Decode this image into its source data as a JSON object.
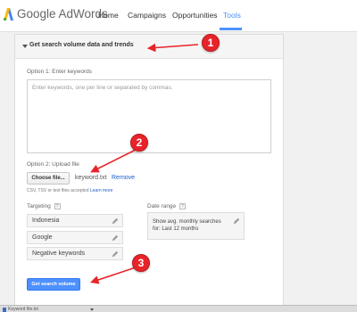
{
  "app": {
    "logo_text": "Google AdWords",
    "logo_colors": {
      "blue": "#4285f4",
      "yellow": "#fbbc05",
      "green": "#34a853"
    }
  },
  "nav": {
    "items": [
      {
        "label": "Home",
        "active": false
      },
      {
        "label": "Campaigns",
        "active": false
      },
      {
        "label": "Opportunities",
        "active": false
      },
      {
        "label": "Tools",
        "active": true
      }
    ],
    "accent_color": "#4d90fe"
  },
  "panel": {
    "title": "Get search volume data and trends",
    "option1": {
      "label": "Option 1: Enter keywords",
      "placeholder": "Enter keywords, one per line or separated by commas."
    },
    "option2": {
      "label": "Option 2: Upload file",
      "choose_button": "Choose file...",
      "filename": "keyword.txt",
      "remove_link": "Remove",
      "help_prefix": "CSV, TSV or text files accepted ",
      "help_link": "Learn more"
    },
    "targeting": {
      "label": "Targeting",
      "help_icon": "?",
      "fields": [
        "Indonesia",
        "Google",
        "Negative keywords"
      ]
    },
    "date_range": {
      "label": "Date range",
      "help_icon": "?",
      "value": "Show avg. monthly searches for: Last 12 months"
    },
    "submit_button": "Get search volume"
  },
  "annotations": {
    "badges": [
      "1",
      "2",
      "3"
    ],
    "color": "#e8232a"
  },
  "bottom_bar": {
    "text": "Keyword file.txt"
  }
}
